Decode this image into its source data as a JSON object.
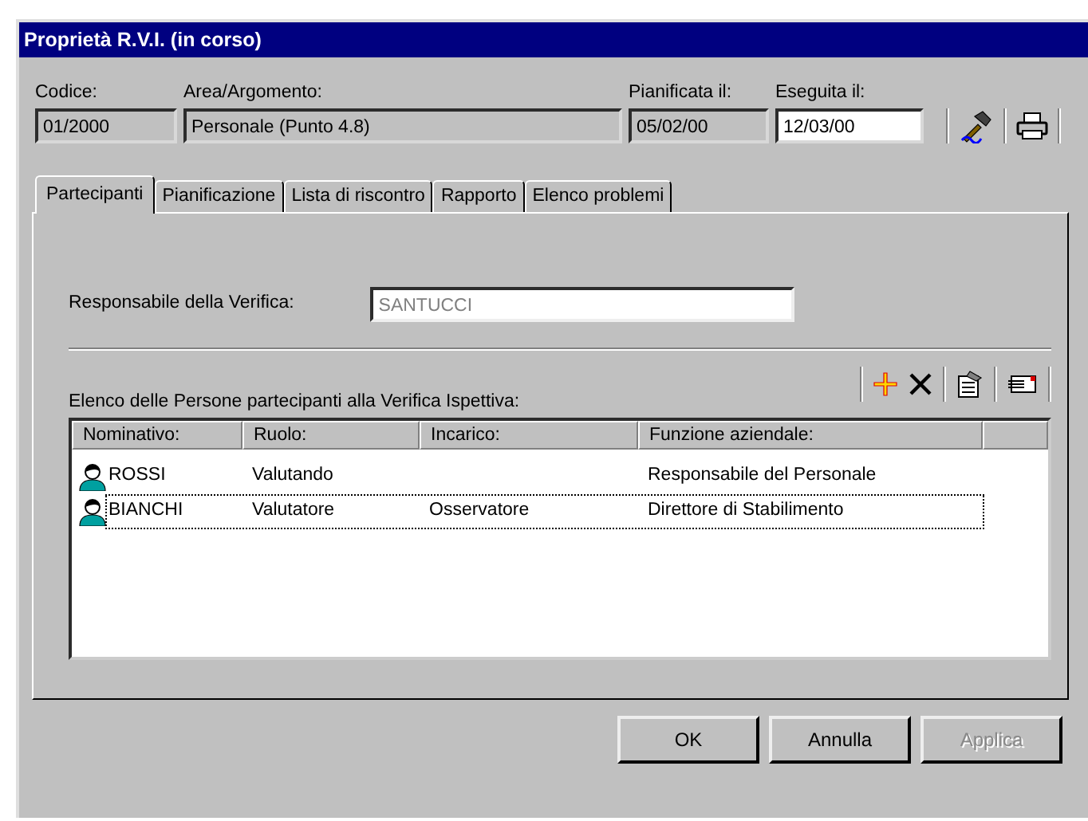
{
  "window": {
    "title": "Proprietà R.V.I. (in corso)"
  },
  "header_fields": [
    {
      "label": "Codice:",
      "value": "01/2000",
      "editable": false
    },
    {
      "label": "Area/Argomento:",
      "value": "Personale (Punto 4.8)",
      "editable": false
    },
    {
      "label": "Pianificata il:",
      "value": "05/02/00",
      "editable": false
    },
    {
      "label": "Eseguita il:",
      "value": "12/03/00",
      "editable": true
    }
  ],
  "tabs": [
    {
      "label": "Partecipanti",
      "selected": true
    },
    {
      "label": "Pianificazione",
      "selected": false
    },
    {
      "label": "Lista di riscontro",
      "selected": false
    },
    {
      "label": "Rapporto",
      "selected": false
    },
    {
      "label": "Elenco problemi",
      "selected": false
    }
  ],
  "responsible": {
    "label": "Responsabile della Verifica:",
    "value": "SANTUCCI",
    "disabled": true
  },
  "list_label": "Elenco delle Persone partecipanti alla Verifica Ispettiva:",
  "table": {
    "columns": [
      "Nominativo:",
      "Ruolo:",
      "Incarico:",
      "Funzione aziendale:"
    ],
    "rows": [
      {
        "cells": [
          "ROSSI",
          "Valutando",
          "",
          "Responsabile del Personale"
        ],
        "selected": false
      },
      {
        "cells": [
          "BIANCHI",
          "Valutatore",
          "Osservatore",
          "Direttore di Stabilimento"
        ],
        "selected": true
      }
    ]
  },
  "buttons": [
    {
      "label": "OK",
      "disabled": false
    },
    {
      "label": "Annulla",
      "disabled": false
    },
    {
      "label": "Applica",
      "disabled": true
    }
  ]
}
